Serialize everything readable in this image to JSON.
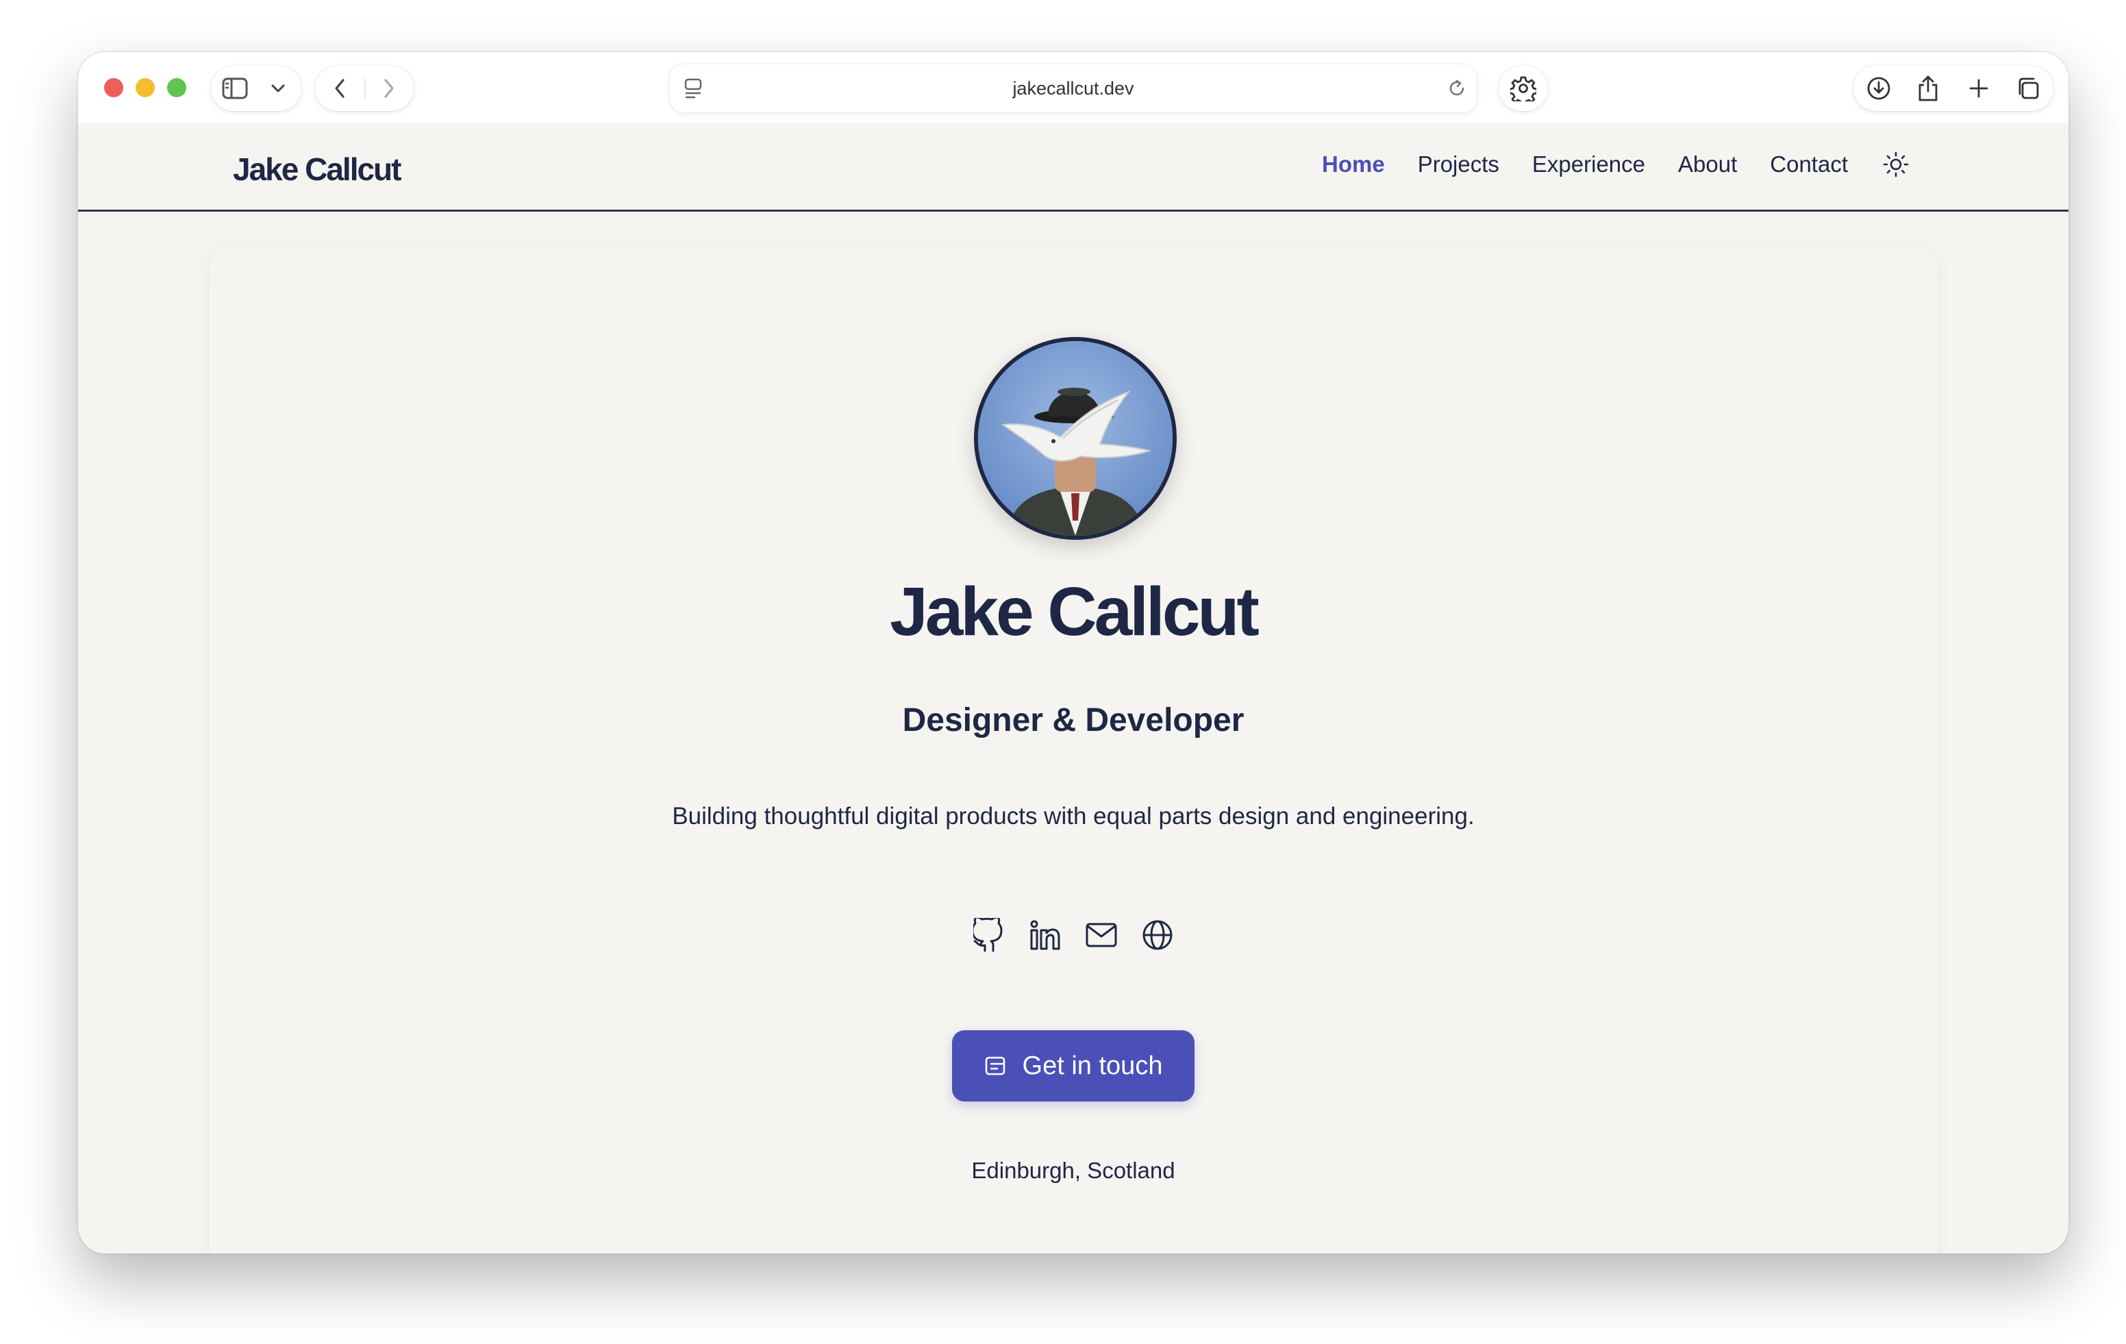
{
  "browser": {
    "url": "jakecallcut.dev",
    "icons": {
      "sidebar": "sidebar-icon",
      "tab_menu": "chevron-down-icon",
      "back": "chevron-left-icon",
      "forward": "chevron-right-icon",
      "page_info": "page-info-icon",
      "reload": "reload-icon",
      "settings": "gear-icon",
      "downloads": "download-icon",
      "share": "share-icon",
      "new_tab": "plus-icon",
      "tab_overview": "tabs-icon"
    }
  },
  "site": {
    "brand": "Jake Callcut",
    "nav": [
      {
        "label": "Home",
        "active": true
      },
      {
        "label": "Projects",
        "active": false
      },
      {
        "label": "Experience",
        "active": false
      },
      {
        "label": "About",
        "active": false
      },
      {
        "label": "Contact",
        "active": false
      }
    ],
    "theme_toggle_icon": "sun-icon"
  },
  "hero": {
    "name": "Jake Callcut",
    "role": "Designer & Developer",
    "tagline": "Building thoughtful digital products with equal parts design and engineering.",
    "socials": [
      "github-icon",
      "linkedin-icon",
      "mail-icon",
      "globe-icon"
    ],
    "cta_label": "Get in touch",
    "cta_icon": "message-icon",
    "location": "Edinburgh, Scotland"
  },
  "colors": {
    "accent": "#4b4fb8",
    "text": "#1e2744",
    "background": "#f5f4f1"
  }
}
